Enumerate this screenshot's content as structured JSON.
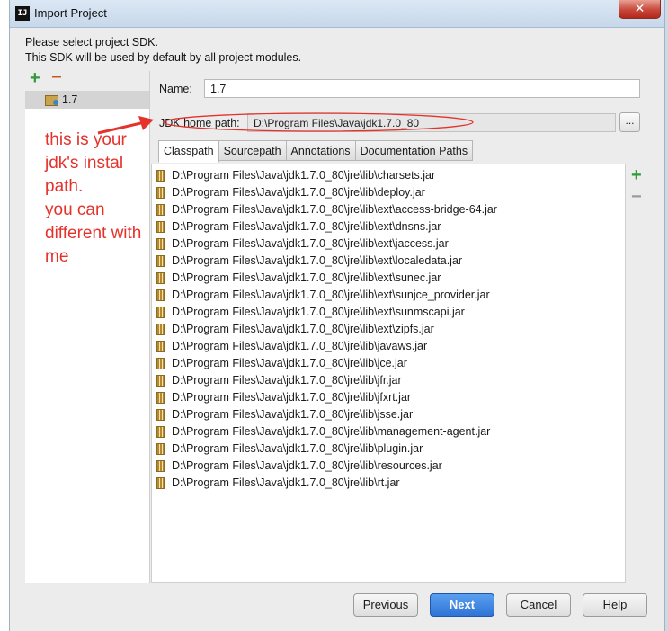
{
  "window": {
    "title": "Import Project",
    "app_icon": "IJ"
  },
  "header": {
    "line1": "Please select project SDK.",
    "line2": "This SDK will be used by default by all project modules."
  },
  "sdk_list": {
    "add_icon": "+",
    "remove_icon": "−",
    "items": [
      "1.7"
    ]
  },
  "form": {
    "name_label": "Name:",
    "name_value": "1.7",
    "jdk_home_label": "JDK home path:",
    "jdk_home_value": "D:\\Program Files\\Java\\jdk1.7.0_80",
    "browse_label": "..."
  },
  "tabs": [
    "Classpath",
    "Sourcepath",
    "Annotations",
    "Documentation Paths"
  ],
  "classpath": [
    "D:\\Program Files\\Java\\jdk1.7.0_80\\jre\\lib\\charsets.jar",
    "D:\\Program Files\\Java\\jdk1.7.0_80\\jre\\lib\\deploy.jar",
    "D:\\Program Files\\Java\\jdk1.7.0_80\\jre\\lib\\ext\\access-bridge-64.jar",
    "D:\\Program Files\\Java\\jdk1.7.0_80\\jre\\lib\\ext\\dnsns.jar",
    "D:\\Program Files\\Java\\jdk1.7.0_80\\jre\\lib\\ext\\jaccess.jar",
    "D:\\Program Files\\Java\\jdk1.7.0_80\\jre\\lib\\ext\\localedata.jar",
    "D:\\Program Files\\Java\\jdk1.7.0_80\\jre\\lib\\ext\\sunec.jar",
    "D:\\Program Files\\Java\\jdk1.7.0_80\\jre\\lib\\ext\\sunjce_provider.jar",
    "D:\\Program Files\\Java\\jdk1.7.0_80\\jre\\lib\\ext\\sunmscapi.jar",
    "D:\\Program Files\\Java\\jdk1.7.0_80\\jre\\lib\\ext\\zipfs.jar",
    "D:\\Program Files\\Java\\jdk1.7.0_80\\jre\\lib\\javaws.jar",
    "D:\\Program Files\\Java\\jdk1.7.0_80\\jre\\lib\\jce.jar",
    "D:\\Program Files\\Java\\jdk1.7.0_80\\jre\\lib\\jfr.jar",
    "D:\\Program Files\\Java\\jdk1.7.0_80\\jre\\lib\\jfxrt.jar",
    "D:\\Program Files\\Java\\jdk1.7.0_80\\jre\\lib\\jsse.jar",
    "D:\\Program Files\\Java\\jdk1.7.0_80\\jre\\lib\\management-agent.jar",
    "D:\\Program Files\\Java\\jdk1.7.0_80\\jre\\lib\\plugin.jar",
    "D:\\Program Files\\Java\\jdk1.7.0_80\\jre\\lib\\resources.jar",
    "D:\\Program Files\\Java\\jdk1.7.0_80\\jre\\lib\\rt.jar"
  ],
  "annotation": {
    "lines": [
      "this is your",
      "jdk's instal",
      "path.",
      "you can",
      "different with",
      "me"
    ],
    "color": "#e5322b"
  },
  "buttons": {
    "previous": "Previous",
    "next": "Next",
    "cancel": "Cancel",
    "help": "Help"
  },
  "colors": {
    "primary_button": "#2f74d5",
    "add_green": "#2e9a39",
    "remove_orange": "#c45a19",
    "close_red": "#c8483a"
  },
  "icons": {
    "add": "plus-icon",
    "remove": "minus-icon",
    "jar": "jar-archive-icon",
    "sdk": "sdk-folder-icon"
  }
}
